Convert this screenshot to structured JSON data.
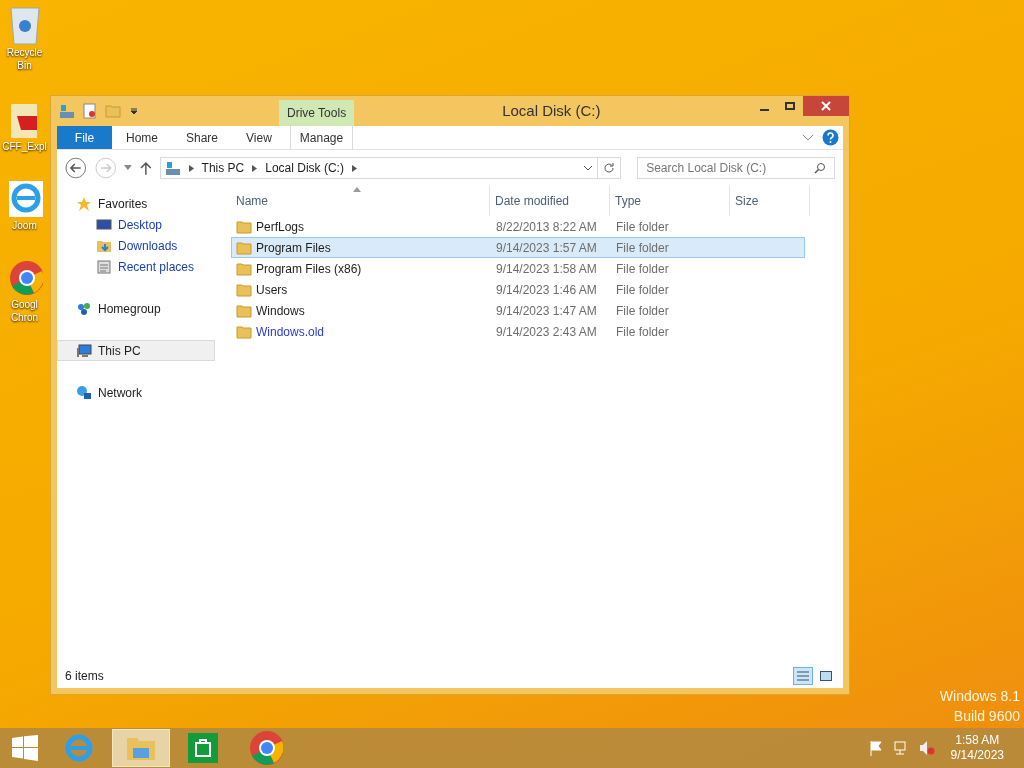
{
  "desktop_icons": [
    {
      "kind": "bin",
      "label": "Recycle Bin"
    },
    {
      "kind": "app",
      "label": "CFF_Expl"
    },
    {
      "kind": "ie",
      "label": "Joom"
    },
    {
      "kind": "chrome",
      "label": "Googl Chron"
    }
  ],
  "window": {
    "title": "Local Disk (C:)",
    "context_tab_group": "Drive Tools"
  },
  "ribbon_tabs": [
    {
      "label": "File",
      "kind": "file"
    },
    {
      "label": "Home",
      "kind": "tab"
    },
    {
      "label": "Share",
      "kind": "tab"
    },
    {
      "label": "View",
      "kind": "tab"
    },
    {
      "label": "Manage",
      "kind": "context"
    }
  ],
  "address": {
    "crumbs": [
      "This PC",
      "Local Disk (C:)"
    ]
  },
  "search": {
    "placeholder": "Search Local Disk (C:)"
  },
  "nav": [
    {
      "label": "Favorites",
      "kind": "star",
      "selected": false,
      "children": [
        {
          "label": "Desktop",
          "kind": "desktop",
          "selected": false
        },
        {
          "label": "Downloads",
          "kind": "downloads",
          "selected": false
        },
        {
          "label": "Recent places",
          "kind": "recent",
          "selected": false
        }
      ]
    },
    {
      "label": "Homegroup",
      "kind": "homegroup",
      "selected": false
    },
    {
      "label": "This PC",
      "kind": "pc",
      "selected": true
    },
    {
      "label": "Network",
      "kind": "network",
      "selected": false
    }
  ],
  "columns": [
    "Name",
    "Date modified",
    "Type",
    "Size"
  ],
  "files": [
    {
      "name": "PerfLogs",
      "date": "8/22/2013 8:22 AM",
      "type": "File folder",
      "selected": false,
      "compressed": false
    },
    {
      "name": "Program Files",
      "date": "9/14/2023 1:57 AM",
      "type": "File folder",
      "selected": true,
      "compressed": false
    },
    {
      "name": "Program Files (x86)",
      "date": "9/14/2023 1:58 AM",
      "type": "File folder",
      "selected": false,
      "compressed": false
    },
    {
      "name": "Users",
      "date": "9/14/2023 1:46 AM",
      "type": "File folder",
      "selected": false,
      "compressed": false
    },
    {
      "name": "Windows",
      "date": "9/14/2023 1:47 AM",
      "type": "File folder",
      "selected": false,
      "compressed": false
    },
    {
      "name": "Windows.old",
      "date": "9/14/2023 2:43 AM",
      "type": "File folder",
      "selected": false,
      "compressed": true
    }
  ],
  "status_bar": "6 items",
  "os_watermark": [
    "Windows 8.1",
    "Build 9600"
  ],
  "taskbar": {
    "apps": [
      {
        "kind": "ie",
        "selected": false
      },
      {
        "kind": "explorer",
        "selected": true
      },
      {
        "kind": "store",
        "selected": false
      },
      {
        "kind": "chrome",
        "selected": false
      }
    ],
    "time": "1:58 AM",
    "date": "9/14/2023"
  }
}
